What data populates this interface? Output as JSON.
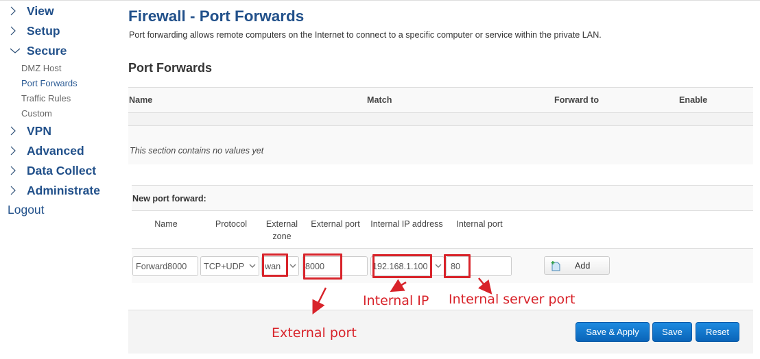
{
  "sidebar": {
    "items": [
      {
        "label": "View",
        "expanded": false
      },
      {
        "label": "Setup",
        "expanded": false
      },
      {
        "label": "Secure",
        "expanded": true
      },
      {
        "label": "VPN",
        "expanded": false
      },
      {
        "label": "Advanced",
        "expanded": false
      },
      {
        "label": "Data Collect",
        "expanded": false
      },
      {
        "label": "Administrate",
        "expanded": false
      }
    ],
    "secure_sub": [
      {
        "label": "DMZ Host",
        "active": false
      },
      {
        "label": "Port Forwards",
        "active": true
      },
      {
        "label": "Traffic Rules",
        "active": false
      },
      {
        "label": "Custom",
        "active": false
      }
    ],
    "logout": "Logout"
  },
  "page": {
    "title": "Firewall - Port Forwards",
    "description": "Port forwarding allows remote computers on the Internet to connect to a specific computer or service within the private LAN.",
    "section_title": "Port Forwards"
  },
  "table": {
    "headers": [
      "Name",
      "Match",
      "Forward to",
      "Enable"
    ],
    "empty_message": "This section contains no values yet"
  },
  "new_forward": {
    "title": "New port forward:",
    "columns": [
      "Name",
      "Protocol",
      "External zone",
      "External port",
      "Internal IP address",
      "Internal port"
    ],
    "values": {
      "name": "Forward8000",
      "protocol": "TCP+UDP",
      "external_zone": "wan",
      "external_port": "8000",
      "internal_ip": "192.168.1.100",
      "internal_port": "80"
    },
    "add_label": "Add"
  },
  "footer": {
    "save_apply": "Save & Apply",
    "save": "Save",
    "reset": "Reset"
  },
  "annotations": {
    "external_port": "External port",
    "internal_ip": "Internal IP",
    "internal_server_port": "Internal server port",
    "color": "#d8232a"
  },
  "colors": {
    "nav_blue": "#21508a",
    "button_blue": "#0a64b8"
  }
}
